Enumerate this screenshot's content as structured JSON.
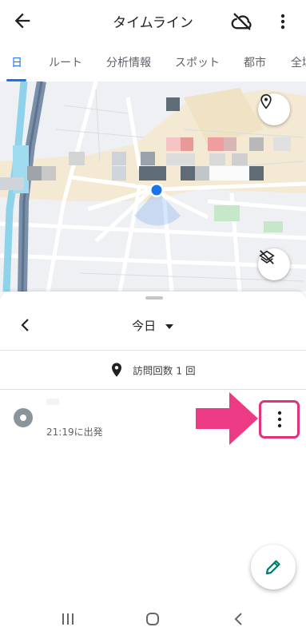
{
  "header": {
    "title": "タイムライン"
  },
  "tabs": [
    {
      "label": "日"
    },
    {
      "label": "ルート"
    },
    {
      "label": "分析情報"
    },
    {
      "label": "スポット"
    },
    {
      "label": "都市"
    },
    {
      "label": "全域"
    }
  ],
  "sheet": {
    "date_label": "今日",
    "visits_summary": "訪問回数 1 回",
    "entry": {
      "time_text": "21:19に出発"
    }
  },
  "colors": {
    "accent": "#1a73e8",
    "highlight_border": "#e2327c",
    "arrow": "#ec3a85",
    "location_dot": "#1a73e8",
    "edit_icon": "#00796b"
  },
  "icons": {
    "back": "arrow-left-icon",
    "cloud_off": "cloud-off-icon",
    "more": "more-vert-icon",
    "map_pin": "location-pin-icon",
    "layers_off": "layers-off-icon",
    "date_back": "chevron-left-icon",
    "dropdown": "triangle-down-icon",
    "edit": "pencil-icon"
  }
}
